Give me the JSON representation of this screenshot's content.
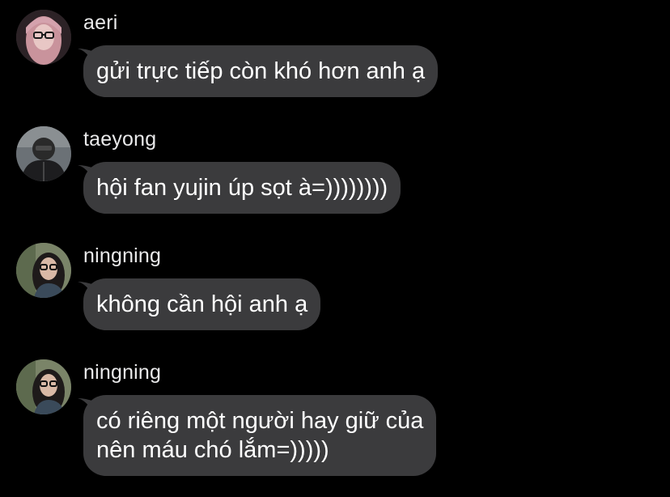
{
  "colors": {
    "background": "#000000",
    "bubble": "#3b3b3d",
    "sender_text": "#e9e9ea",
    "message_text": "#ffffff"
  },
  "messages": [
    {
      "sender": "aeri",
      "text": "gửi trực tiếp còn khó hơn anh ạ"
    },
    {
      "sender": "taeyong",
      "text": "hội fan yujin úp sọt à=))))))))"
    },
    {
      "sender": "ningning",
      "text": "không cần hội anh ạ"
    },
    {
      "sender": "ningning",
      "text": "có riêng một người hay giữ của\nnên máu chó lắm=)))))"
    }
  ]
}
